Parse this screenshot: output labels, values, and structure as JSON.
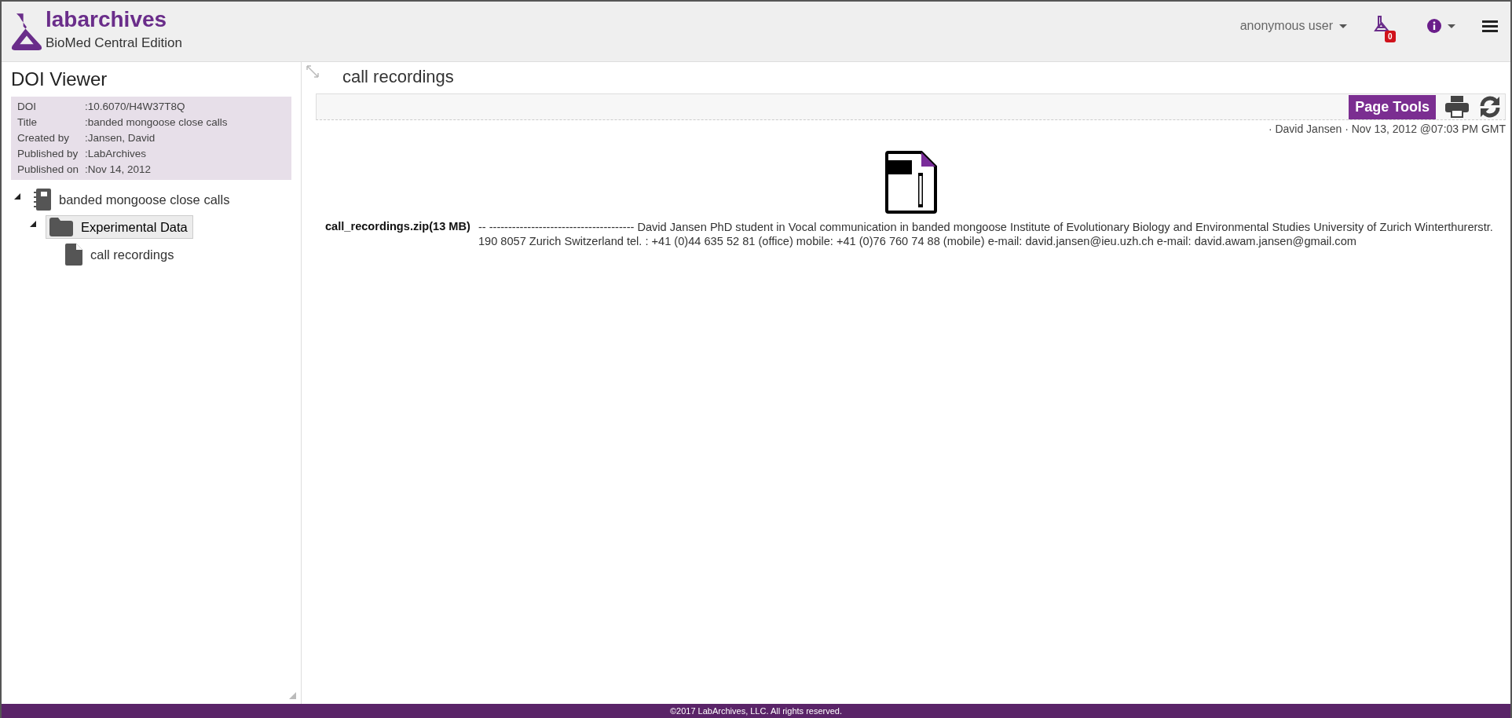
{
  "header": {
    "logo": "labarchives",
    "edition": "BioMed Central Edition",
    "user_menu": "anonymous user",
    "notification_count": "0"
  },
  "sidebar": {
    "title": "DOI Viewer",
    "details": [
      {
        "label": "DOI",
        "value": ":10.6070/H4W37T8Q"
      },
      {
        "label": "Title",
        "value": ":banded mongoose close calls"
      },
      {
        "label": "Created by",
        "value": ":Jansen, David"
      },
      {
        "label": "Published by",
        "value": ":LabArchives"
      },
      {
        "label": "Published on",
        "value": ":Nov 14, 2012"
      }
    ],
    "tree": [
      {
        "label": "banded mongoose close calls",
        "kind": "notebook",
        "expanded": true,
        "selected": false,
        "children": [
          {
            "label": "Experimental Data",
            "kind": "folder",
            "expanded": true,
            "selected": true,
            "children": [
              {
                "label": "call recordings",
                "kind": "page",
                "selected": false
              }
            ]
          }
        ]
      }
    ]
  },
  "page": {
    "title": "call recordings",
    "tools_button": "Page Tools",
    "meta": "· David Jansen · Nov 13, 2012 @07:03 PM GMT",
    "attachment": {
      "file_name": "call_recordings.zip(13 MB)",
      "description": "-- -------------------------------------- David Jansen PhD student in Vocal communication in banded mongoose Institute of Evolutionary Biology and Environmental Studies University of Zurich Winterthurerstr. 190 8057 Zurich Switzerland tel. : +41 (0)44 635 52 81 (office) mobile: +41 (0)76 760 74 88 (mobile) e-mail: david.jansen@ieu.uzh.ch e-mail: david.awam.jansen@gmail.com"
    }
  },
  "footer": "©2017 LabArchives, LLC. All rights reserved."
}
